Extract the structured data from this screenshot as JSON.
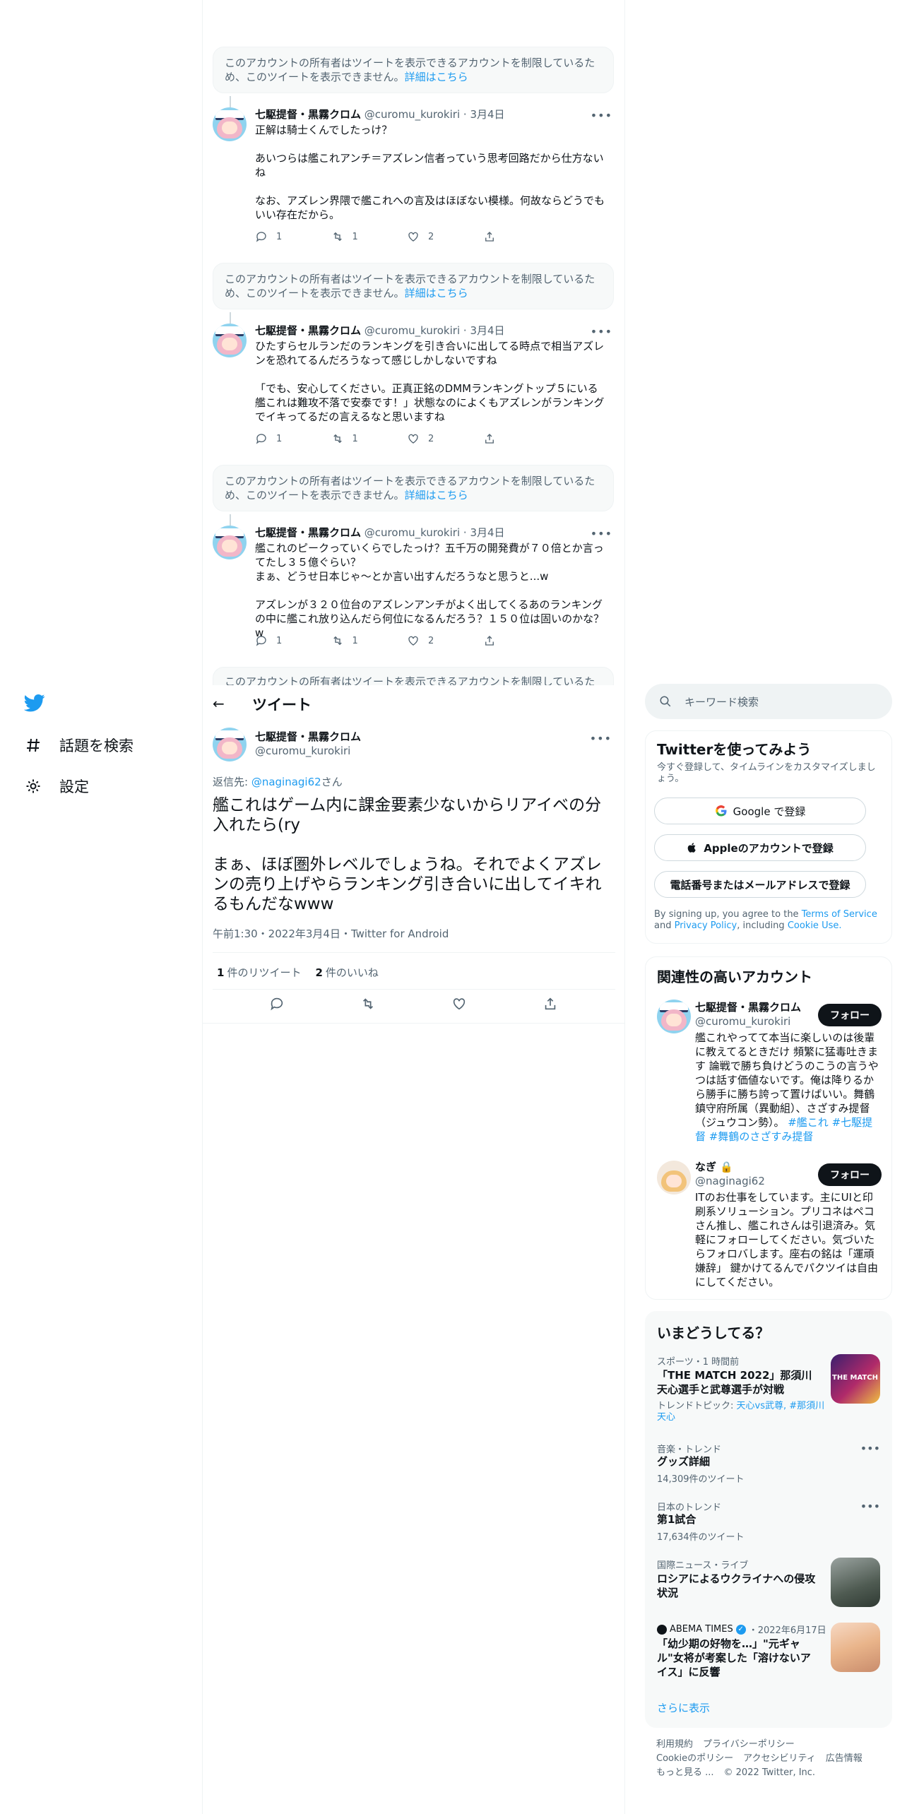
{
  "nav": {
    "explore_label": "話題を検索",
    "settings_label": "設定"
  },
  "notice": {
    "text": "このアカウントの所有者はツイートを表示できるアカウントを制限しているため、このツイートを表示できません。",
    "link": "詳細はこちら",
    "partial": "このアカウントの所有者はツイートを表示できるアカウントを制限しているた"
  },
  "replies": [
    {
      "name": "七駆提督・黒霧クロム",
      "handle": "@curomu_kurokiri",
      "date": "3月4日",
      "text": "正解は騎士くんでしたっけ？\n\nあいつらは艦これアンチ＝アズレン信者っていう思考回路だから仕方ないね\n\nなお、アズレン界隈で艦これへの言及はほぼない模様。何故ならどうでもいい存在だから。",
      "replies": "1",
      "retweets": "1",
      "likes": "2"
    },
    {
      "name": "七駆提督・黒霧クロム",
      "handle": "@curomu_kurokiri",
      "date": "3月4日",
      "text": "ひたすらセルランだのランキングを引き合いに出してる時点で相当アズレンを恐れてるんだろうなって感じしかしないですね\n\n「でも、安心してください。正真正銘のDMMランキングトップ５にいる艦これは難攻不落で安泰です！」状態なのによくもアズレンがランキングでイキってるだの言えるなと思いますね",
      "replies": "1",
      "retweets": "1",
      "likes": "2"
    },
    {
      "name": "七駆提督・黒霧クロム",
      "handle": "@curomu_kurokiri",
      "date": "3月4日",
      "text": "艦これのピークっていくらでしたっけ？五千万の開発費が７０倍とか言ってたし３５億ぐらい？\nまぁ、どうせ日本じゃ～とか言い出すんだろうなと思うと...w\n\nアズレンが３２０位台のアズレンアンチがよく出してくるあのランキングの中に艦これ放り込んだら何位になるんだろう？１５０位は固いのかな？w",
      "replies": "1",
      "retweets": "1",
      "likes": "2"
    }
  ],
  "header": {
    "title": "ツイート"
  },
  "main_tweet": {
    "name": "七駆提督・黒霧クロム",
    "handle": "@curomu_kurokiri",
    "replying_prefix": "返信先: ",
    "replying_to": "@naginagi62",
    "replying_suffix": "さん",
    "text": "艦これはゲーム内に課金要素少ないからリアイベの分入れたら(ry\n\nまぁ、ほぼ圏外レベルでしょうね。それでよくアズレンの売り上げやらランキング引き合いに出してイキれるもんだなwww",
    "meta": "午前1:30・2022年3月4日・Twitter for Android",
    "retweet_count": "1",
    "retweet_label": "件のリツイート",
    "like_count": "2",
    "like_label": "件のいいね"
  },
  "search": {
    "placeholder": "キーワード検索"
  },
  "signup": {
    "title": "Twitterを使ってみよう",
    "subtitle": "今すぐ登録して、タイムラインをカスタマイズしましょう。",
    "google": "Google で登録",
    "apple": "Appleのアカウントで登録",
    "phone": "電話番号またはメールアドレスで登録",
    "terms_prefix": "By signing up, you agree to the ",
    "terms_link": "Terms of Service",
    "terms_and": " and ",
    "privacy_link": "Privacy Policy",
    "terms_including": ", including ",
    "cookie_link": "Cookie Use."
  },
  "related": {
    "title": "関連性の高いアカウント",
    "follow_label": "フォロー",
    "accounts": [
      {
        "name": "七駆提督・黒霧クロム",
        "handle": "@curomu_kurokiri",
        "bio": "艦これやってて本当に楽しいのは後輩に教えてるときだけ 頻繁に猛毒吐きます 論戦で勝ち負けどうのこうの言うやつは話す価値ないです。俺は降りるから勝手に勝ち誇って置けばいい。舞鶴鎮守府所属（異動組）、さざすみ提督（ジュウコン勢）。",
        "tags": "#艦これ #七駆提督 #舞鶴のさざすみ提督"
      },
      {
        "name": "なぎ",
        "handle": "@naginagi62",
        "bio": "ITのお仕事をしています。主にUIと印刷系ソリューション。プリコネはペコさん推し、艦これさんは引退済み。気軽にフォローしてください。気づいたらフォロバします。座右の銘は「運頑嫌辞」 鍵かけてるんでパクツイは自由にしてください。",
        "tags": ""
      }
    ]
  },
  "trends": {
    "title": "いまどうしてる？",
    "items": [
      {
        "meta": "スポーツ・1 時間前",
        "title": "「THE MATCH 2022」那須川天心選手と武尊選手が対戦",
        "topic_prefix": "トレンドトピック: ",
        "topic": "天心vs武尊, #那須川天心"
      },
      {
        "meta": "音楽・トレンド",
        "title": "グッズ詳細",
        "count": "14,309件のツイート"
      },
      {
        "meta": "日本のトレンド",
        "title": "第1試合",
        "count": "17,634件のツイート"
      },
      {
        "meta": "国際ニュース・ライブ",
        "title": "ロシアによるウクライナへの侵攻状況"
      },
      {
        "source": "ABEMA TIMES",
        "date": "・2022年6月17日",
        "title": "「幼少期の好物を…」\"元ギャル\"女将が考案した「溶けないアイス」に反響"
      }
    ],
    "show_more": "さらに表示",
    "image_text": "THE MATCH 2022"
  },
  "footer": {
    "links": [
      "利用規約",
      "プライバシーポリシー",
      "Cookieのポリシー",
      "アクセシビリティ",
      "広告情報",
      "もっと見る ..."
    ],
    "copyright": "© 2022 Twitter, Inc."
  },
  "colors": {
    "accent": "#1d9bf0",
    "text": "#0f1419",
    "muted": "#536471"
  }
}
